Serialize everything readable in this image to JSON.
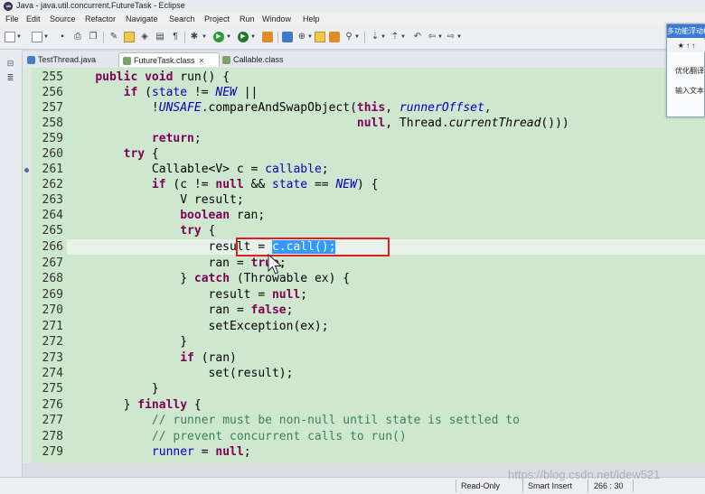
{
  "window": {
    "title": "Java - java.util.concurrent.FutureTask - Eclipse"
  },
  "menu": [
    "File",
    "Edit",
    "Source",
    "Refactor",
    "Navigate",
    "Search",
    "Project",
    "Run",
    "Window",
    "Help"
  ],
  "tabs": [
    {
      "label": "TestThread.java",
      "active": false
    },
    {
      "label": "FutureTask.class",
      "active": true
    },
    {
      "label": "Callable.class",
      "active": false
    }
  ],
  "editor": {
    "first_line": 255,
    "line_numbers": [
      "255",
      "256",
      "257",
      "258",
      "259",
      "260",
      "261",
      "262",
      "263",
      "264",
      "265",
      "266",
      "267",
      "268",
      "269",
      "270",
      "271",
      "272",
      "273",
      "274",
      "275",
      "276",
      "277",
      "278",
      "279"
    ],
    "code": [
      "    public void run() {",
      "        if (state != NEW ||",
      "            !UNSAFE.compareAndSwapObject(this, runnerOffset,",
      "                                         null, Thread.currentThread()))",
      "            return;",
      "        try {",
      "            Callable<V> c = callable;",
      "            if (c != null && state == NEW) {",
      "                V result;",
      "                boolean ran;",
      "                try {",
      "                    result = c.call();",
      "                    ran = true;",
      "                } catch (Throwable ex) {",
      "                    result = null;",
      "                    ran = false;",
      "                    setException(ex);",
      "                }",
      "                if (ran)",
      "                    set(result);",
      "            }",
      "        } finally {",
      "            // runner must be non-null until state is settled to",
      "            // prevent concurrent calls to run()",
      "            runner = null;"
    ],
    "highlighted_line": "266",
    "selected_text": "c.call();"
  },
  "popup": {
    "title": "多功能浮动框",
    "toolbar": "★ ↑ ↑",
    "line1": "优化翻译",
    "line2": "输入文本"
  },
  "status": {
    "mode": "Read-Only",
    "insert": "Smart Insert",
    "position": "266 : 30"
  },
  "watermark": "https://blog.csdn.net/ldew521",
  "colors": {
    "editor_bg": "#cde8cf",
    "keyword": "#7f0055",
    "field": "#0000c0",
    "comment": "#3f7f5f",
    "selection": "#3399ff",
    "annotation_box": "#e11d1d"
  }
}
